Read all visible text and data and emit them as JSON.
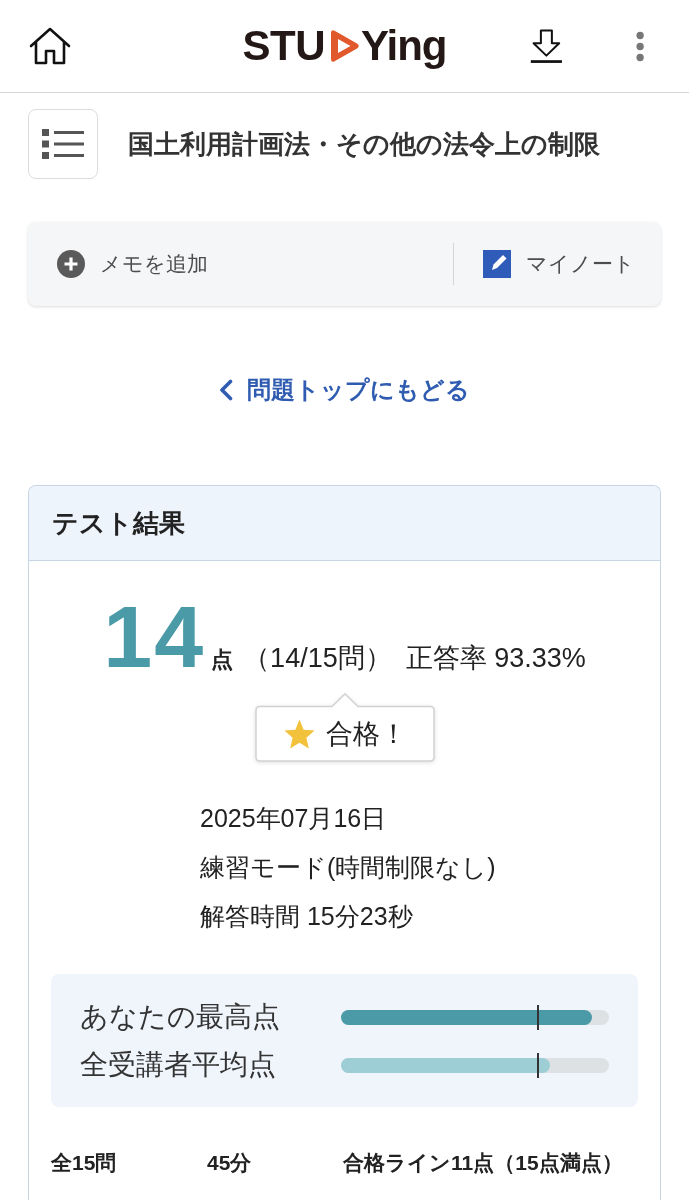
{
  "header": {
    "logo": {
      "before": "STU",
      "after": "Ying"
    }
  },
  "lesson": {
    "title": "国土利用計画法・その他の法令上の制限"
  },
  "toolbar": {
    "memo_button": "メモを追加",
    "note_button": "マイノート"
  },
  "back_link": "問題トップにもどる",
  "result_card": {
    "title": "テスト結果",
    "score": "14",
    "score_unit": "点",
    "detail": "（14/15問）",
    "rate": "正答率 93.33%",
    "badge": "合格！",
    "info": [
      "2025年07月16日",
      "練習モード(時間制限なし)",
      "解答時間 15分23秒"
    ],
    "bars": [
      {
        "label": "あなたの最高点",
        "level": 0.935,
        "color": "#4b9aa8",
        "pass_mark": {
          "level": 0.733
        }
      },
      {
        "label": "全受講者平均点",
        "level": 0.78,
        "color": "#9dcdd5",
        "pass_mark": {
          "level": 0.733
        }
      }
    ],
    "summary": [
      "全15問",
      "45分",
      "合格ライン11点（15点満点）"
    ]
  }
}
